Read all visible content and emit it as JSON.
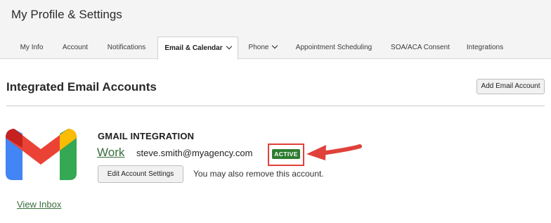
{
  "header": {
    "title": "My Profile & Settings",
    "tabs": [
      {
        "label": "My Info"
      },
      {
        "label": "Account"
      },
      {
        "label": "Notifications"
      },
      {
        "label": "Email & Calendar"
      },
      {
        "label": "Phone"
      },
      {
        "label": "Appointment Scheduling"
      },
      {
        "label": "SOA/ACA Consent"
      },
      {
        "label": "Integrations"
      }
    ],
    "active_tab": "Email & Calendar"
  },
  "main": {
    "section_title": "Integrated Email Accounts",
    "add_button_label": "Add Email Account",
    "integration": {
      "logo": "gmail-logo-icon",
      "title": "GMAIL INTEGRATION",
      "account_label": "Work",
      "email": "steve.smith@myagency.com",
      "status": "ACTIVE",
      "edit_button_label": "Edit Account Settings",
      "remove_note": "You may also remove this account.",
      "view_inbox_label": "View Inbox"
    }
  },
  "colors": {
    "header_bg": "#f4f4f4",
    "link_green": "#3a6e3c",
    "active_badge": "#2e7d32",
    "annotation_red": "#e0413a"
  }
}
